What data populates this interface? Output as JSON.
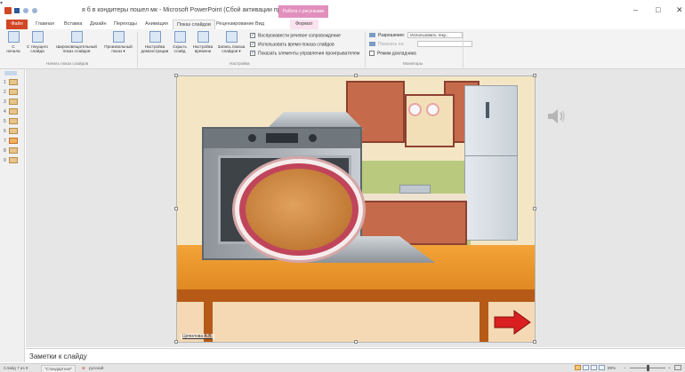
{
  "window": {
    "title": "я б в кондитеры пошел  мк - Microsoft PowerPoint (Сбой активации продукта)",
    "contextual_header": "Работа с рисунками",
    "minimize": "–",
    "maximize": "□",
    "close": "✕",
    "qat_more": "▾"
  },
  "ribbon_tabs": {
    "file": "Файл",
    "home": "Главная",
    "insert": "Вставка",
    "design": "Дизайн",
    "transitions": "Переходы",
    "animations": "Анимация",
    "slideshow": "Показ слайдов",
    "review": "Рецензирование",
    "view": "Вид",
    "format": "Формат"
  },
  "ribbon_help": "?",
  "ribbon": {
    "from_start": "С\nначала",
    "from_current": "С текущего\nслайда",
    "broadcast": "Широковещательный\nпоказ слайдов",
    "custom_show": "Произвольный\nпоказ ▾",
    "group_start": "Начать показ слайдов",
    "setup_show": "Настройка\nдемонстрации",
    "hide_slide": "Скрыть\nслайд",
    "rehearse": "Настройка\nвремени",
    "record": "Запись показа\nслайдов ▾",
    "group_setup": "Настройка",
    "chk_narration": "Воспроизвести речевое сопровождение",
    "chk_timings": "Использовать время показа слайдов",
    "chk_controls": "Показать элементы управления проигрывателем",
    "resolution_label": "Разрешение:",
    "resolution_value": "Использовать теку...",
    "show_on_label": "Показать на:",
    "presenter_view": "Режим докладчика",
    "group_monitors": "Мониторы"
  },
  "thumbnails": [
    {
      "num": "1"
    },
    {
      "num": "2"
    },
    {
      "num": "3"
    },
    {
      "num": "4"
    },
    {
      "num": "5"
    },
    {
      "num": "6"
    },
    {
      "num": "7"
    },
    {
      "num": "8"
    },
    {
      "num": "9"
    }
  ],
  "slide": {
    "author": "Цепилова А.В."
  },
  "notes": {
    "placeholder": "Заметки к слайду"
  },
  "status": {
    "slide_info": "Слайд 7 из 9",
    "theme": "\"Стандартная\"",
    "language": "русский",
    "zoom": "89%",
    "zoom_minus": "–",
    "zoom_plus": "+"
  },
  "colors": {
    "file_tab": "#d24726",
    "contextual_tab": "#e28fbe",
    "arrow": "#d91f1f"
  }
}
